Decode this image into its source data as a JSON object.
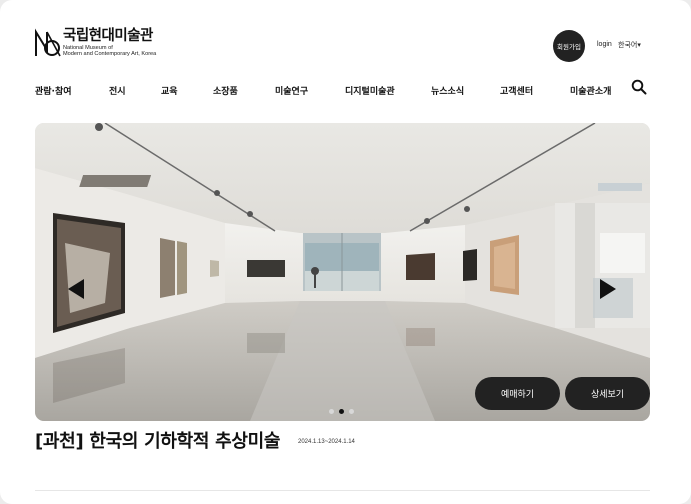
{
  "logo": {
    "korean": "국립현대미술관",
    "english_lines": [
      "National Museum of",
      "Modern and Contemporary Art, Korea"
    ]
  },
  "header": {
    "join_label": "회원가입",
    "login_label": "login",
    "language_label": "한국어▾"
  },
  "nav": {
    "items": [
      "관람·참여",
      "전시",
      "교육",
      "소장품",
      "미술연구",
      "디지털미술관",
      "뉴스소식",
      "고객센터",
      "미술관소개"
    ]
  },
  "hero": {
    "book_label": "예매하기",
    "detail_label": "상세보기",
    "slide_count": 3,
    "active_slide": 2
  },
  "exhibition": {
    "title": "[과천] 한국의 기하학적 추상미술",
    "date": "2024.1.13~2024.1.14"
  },
  "icons": [
    "logo-icon",
    "search-icon",
    "prev-arrow-icon",
    "next-arrow-icon"
  ]
}
